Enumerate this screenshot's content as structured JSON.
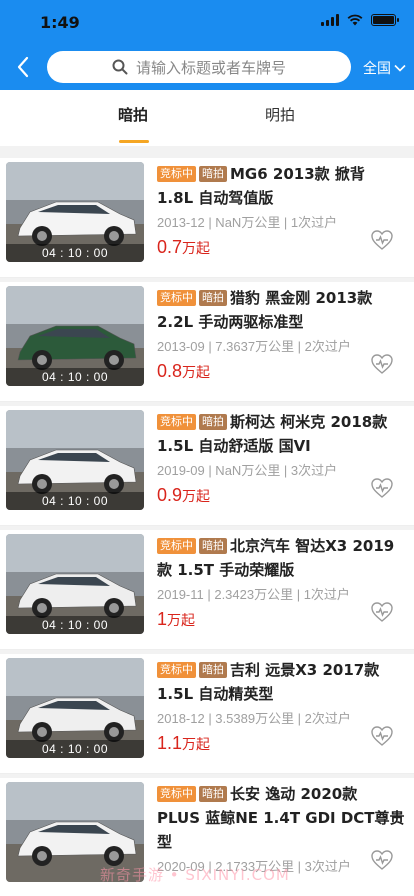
{
  "status_bar": {
    "time": "1:49"
  },
  "header": {
    "search_placeholder": "请输入标题或者车牌号",
    "region": "全国"
  },
  "tabs": [
    {
      "label": "暗拍",
      "active": true
    },
    {
      "label": "明拍",
      "active": false
    }
  ],
  "cars": [
    {
      "badge_status": "竞标中",
      "badge_type": "暗拍",
      "title": "MG6 2013款 掀背 1.8L 自动驾值版",
      "meta": "2013-12 | NaN万公里 | 1次过户",
      "price": "0.7",
      "price_unit": "万起",
      "timer": "04 : 10 : 00",
      "color": "#f4f4f4"
    },
    {
      "badge_status": "竞标中",
      "badge_type": "暗拍",
      "title": "猎豹 黑金刚 2013款 2.2L 手动两驱标准型",
      "meta": "2013-09 | 7.3637万公里 | 2次过户",
      "price": "0.8",
      "price_unit": "万起",
      "timer": "04 : 10 : 00",
      "color": "#2c5a3a"
    },
    {
      "badge_status": "竞标中",
      "badge_type": "暗拍",
      "title": "斯柯达 柯米克 2018款 1.5L 自动舒适版 国VI",
      "meta": "2019-09 | NaN万公里 | 3次过户",
      "price": "0.9",
      "price_unit": "万起",
      "timer": "04 : 10 : 00",
      "color": "#f2f2f2"
    },
    {
      "badge_status": "竞标中",
      "badge_type": "暗拍",
      "title": "北京汽车 智达X3 2019款 1.5T 手动荣耀版",
      "meta": "2019-11 | 2.3423万公里 | 1次过户",
      "price": "1",
      "price_unit": "万起",
      "timer": "04 : 10 : 00",
      "color": "#eeeeee"
    },
    {
      "badge_status": "竞标中",
      "badge_type": "暗拍",
      "title": "吉利 远景X3 2017款 1.5L 自动精英型",
      "meta": "2018-12 | 3.5389万公里 | 2次过户",
      "price": "1.1",
      "price_unit": "万起",
      "timer": "04 : 10 : 00",
      "color": "#efefef"
    },
    {
      "badge_status": "竞标中",
      "badge_type": "暗拍",
      "title": "长安 逸动 2020款 PLUS 蓝鲸NE 1.4T GDI DCT尊贵型",
      "meta": "2020-09 | 2.1733万公里 | 3次过户",
      "price": "",
      "price_unit": "",
      "timer": "",
      "color": "#f2f2f2"
    }
  ],
  "watermark": "新奇手游 • SIXINYI.COM"
}
